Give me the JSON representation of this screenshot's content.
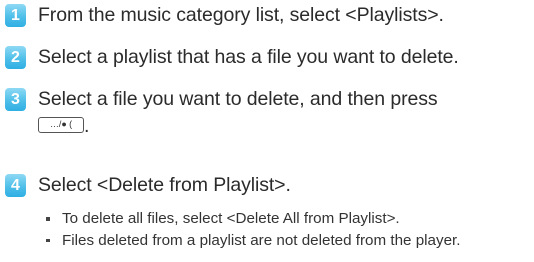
{
  "steps": [
    {
      "number": "1",
      "text": "From the music category list, select <Playlists>."
    },
    {
      "number": "2",
      "text": "Select a playlist that has a file you want to delete."
    },
    {
      "number": "3",
      "line1": "Select a file you want to delete, and then press",
      "button_label": "…/● (",
      "line2_suffix": "."
    },
    {
      "number": "4",
      "text": "Select <Delete from Playlist>."
    }
  ],
  "notes": [
    "To delete all files, select <Delete All from Playlist>.",
    "Files deleted from a playlist are not deleted from the player."
  ],
  "colors": {
    "badge": "#2eaee3",
    "text": "#2b2b2b"
  }
}
